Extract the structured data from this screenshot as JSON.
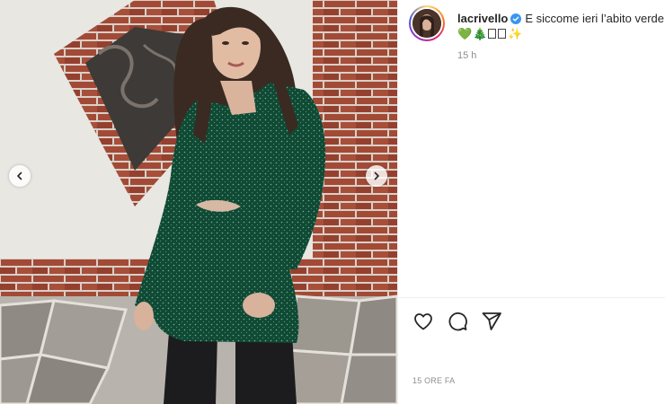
{
  "post": {
    "username": "lacrivello",
    "caption": "E siccome ieri l’abito verde",
    "caption_emojis": [
      "💚",
      "🎄",
      "□",
      "□",
      "✨"
    ],
    "relative_time": "15 h",
    "date_label": "15 ORE FA"
  },
  "icons": {
    "verified": "verified-badge-icon",
    "prev": "chevron-left-icon",
    "next": "chevron-right-icon",
    "like": "heart-icon",
    "comment": "comment-bubble-icon",
    "share": "paper-plane-icon"
  },
  "colors": {
    "verified_blue": "#3897f0",
    "dress_green": "#0f4a35",
    "brick": "#9a4533",
    "wall": "#ecebe6",
    "muted_text": "#8e8e8e"
  }
}
